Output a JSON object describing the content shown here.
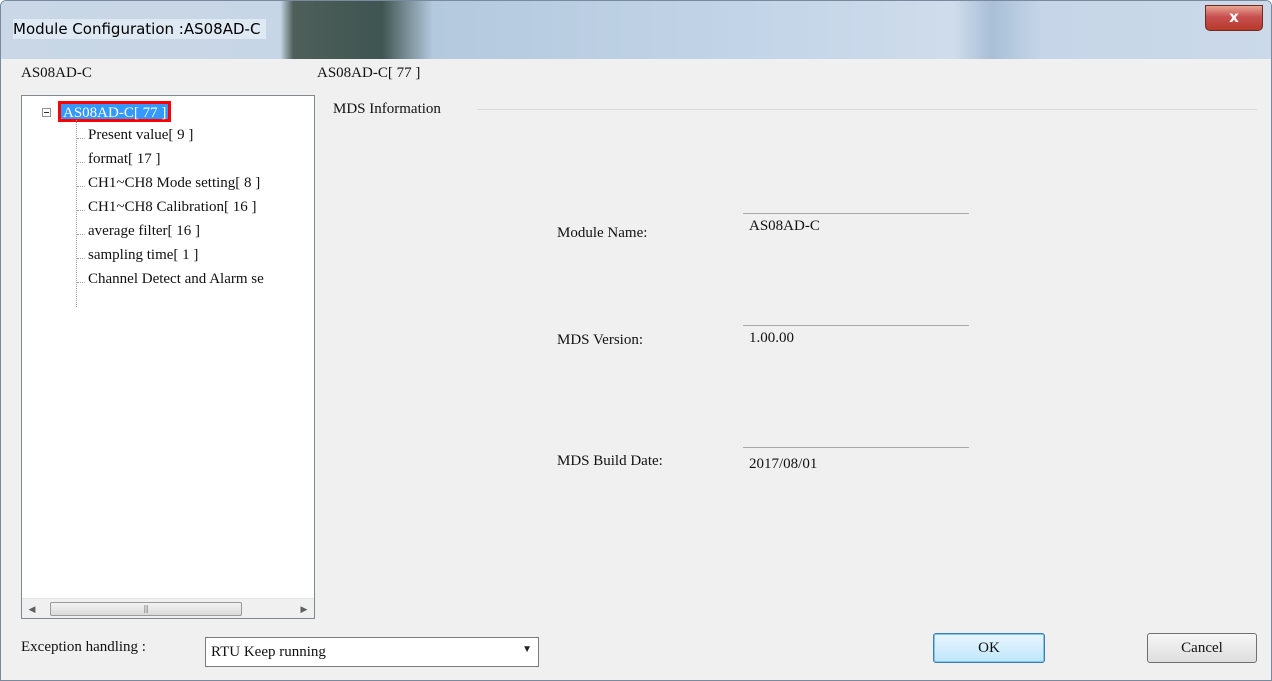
{
  "window": {
    "title": "Module Configuration :AS08AD-C",
    "close_glyph": "x"
  },
  "left_header": "AS08AD-C",
  "right_header": "AS08AD-C[ 77 ]",
  "tree": {
    "root": {
      "label": "AS08AD-C[ 77 ]",
      "selected": true,
      "expanded": true
    },
    "children": [
      {
        "label": "Present value[ 9 ]"
      },
      {
        "label": "format[ 17 ]"
      },
      {
        "label": "CH1~CH8 Mode setting[ 8 ]"
      },
      {
        "label": "CH1~CH8 Calibration[ 16 ]"
      },
      {
        "label": "average filter[ 16 ]"
      },
      {
        "label": "sampling time[ 1 ]"
      },
      {
        "label": "Channel Detect and Alarm se"
      }
    ]
  },
  "scrollbar": {
    "left": "◀",
    "right": "▶",
    "grip": "|||"
  },
  "mds": {
    "group_title": "MDS Information",
    "module_name_label": "Module Name:",
    "module_name_value": "AS08AD-C",
    "version_label": "MDS Version:",
    "version_value": "1.00.00",
    "build_date_label": "MDS Build Date:",
    "build_date_value": "2017/08/01"
  },
  "footer": {
    "exception_label": "Exception handling :",
    "exception_value": "RTU Keep running",
    "dropdown_glyph": "▼",
    "ok_label": "OK",
    "cancel_label": "Cancel"
  },
  "colors": {
    "selection": "#3399ff",
    "highlight_box": "#ff0000",
    "close_button": "#c75050"
  },
  "icons": [
    "close-icon",
    "collapse-icon",
    "scroll-left-icon",
    "scroll-right-icon",
    "dropdown-arrow-icon"
  ]
}
